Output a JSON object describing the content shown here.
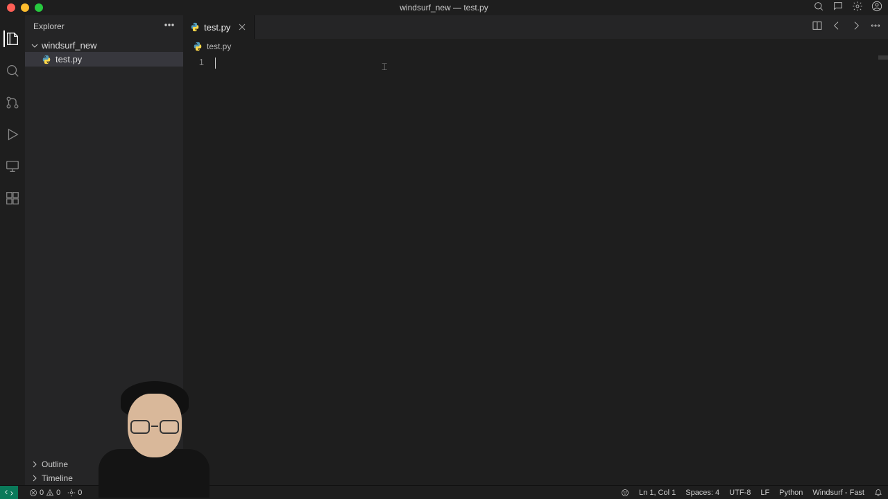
{
  "titlebar": {
    "title": "windsurf_new — test.py"
  },
  "sidebar": {
    "title": "Explorer",
    "folder": "windsurf_new",
    "files": [
      {
        "name": "test.py"
      }
    ],
    "sections": {
      "outline": "Outline",
      "timeline": "Timeline"
    }
  },
  "tabs": [
    {
      "label": "test.py"
    }
  ],
  "breadcrumb": {
    "file": "test.py"
  },
  "editor": {
    "line_number": "1",
    "content": ""
  },
  "statusbar": {
    "errors": "0",
    "warnings": "0",
    "ports": "0",
    "cursor_pos": "Ln 1, Col 1",
    "spaces": "Spaces: 4",
    "encoding": "UTF-8",
    "eol": "LF",
    "language": "Python",
    "provider": "Windsurf - Fast"
  }
}
